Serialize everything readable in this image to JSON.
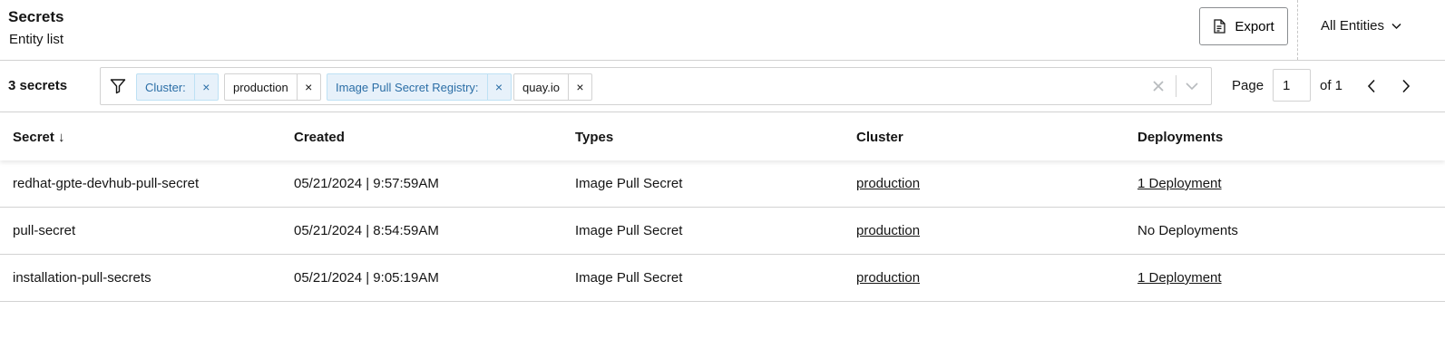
{
  "header": {
    "title": "Secrets",
    "subtitle": "Entity list",
    "export_label": "Export",
    "entities_label": "All Entities"
  },
  "toolbar": {
    "count": "3 secrets",
    "chips": [
      {
        "text": "Cluster:",
        "kind": "key"
      },
      {
        "text": "production",
        "kind": "value"
      },
      {
        "text": "Image Pull Secret Registry:",
        "kind": "key"
      },
      {
        "text": "quay.io",
        "kind": "value"
      }
    ],
    "chip_remove_glyph": "×",
    "page_label": "Page",
    "page_value": "1",
    "of_label": "of 1"
  },
  "table": {
    "columns": [
      "Secret ↓",
      "Created",
      "Types",
      "Cluster",
      "Deployments"
    ],
    "rows": [
      {
        "secret": "redhat-gpte-devhub-pull-secret",
        "created": "05/21/2024 | 9:57:59AM",
        "types": "Image Pull Secret",
        "cluster": "production",
        "deployments": "1 Deployment",
        "deployments_link": true
      },
      {
        "secret": "pull-secret",
        "created": "05/21/2024 | 8:54:59AM",
        "types": "Image Pull Secret",
        "cluster": "production",
        "deployments": "No Deployments",
        "deployments_link": false
      },
      {
        "secret": "installation-pull-secrets",
        "created": "05/21/2024 | 9:05:19AM",
        "types": "Image Pull Secret",
        "cluster": "production",
        "deployments": "1 Deployment",
        "deployments_link": true
      }
    ]
  },
  "icons": {
    "export": "document-icon",
    "entities": "chevron-down-icon",
    "filter": "filter-icon",
    "clear": "close-icon",
    "toggle": "chevron-down-icon",
    "prev": "chevron-left-icon",
    "next": "chevron-right-icon"
  },
  "colors": {
    "chip_key_bg": "#e7f1fa",
    "chip_key_text": "#2b6ea6",
    "border": "#d2d2d2"
  }
}
